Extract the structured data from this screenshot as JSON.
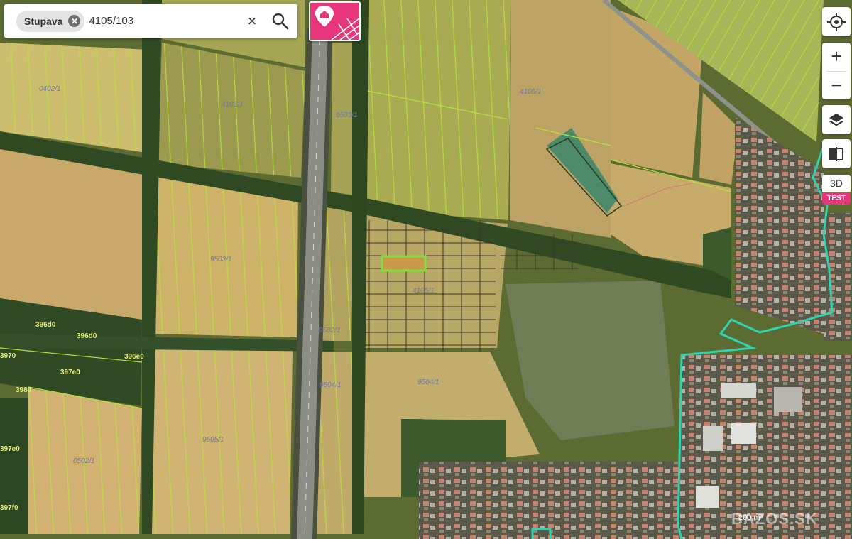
{
  "search": {
    "location_chip": "Stupava",
    "query": "4105/103"
  },
  "controls": {
    "locate_icon": "crosshair-icon",
    "zoom_in": "+",
    "zoom_out": "−",
    "layers_icon": "layers-icon",
    "compare_icon": "compare-icon",
    "view_3d": "3D",
    "test_badge": "TEST"
  },
  "map": {
    "parcel_labels": [
      "0402/1",
      "4103/1",
      "9503/1",
      "4105/1",
      "9504/1",
      "0502/1",
      "9502/1",
      "9504/1",
      "9505/1",
      "4105/1",
      "9503/1"
    ],
    "forest_labels": [
      "396d0",
      "3970",
      "397e0",
      "396d0",
      "397e0",
      "397f0",
      "3980",
      "396e0"
    ],
    "highlight_color": "#7fe03a",
    "boundary_color": "#b8e23a",
    "district_boundary_color": "#2ed3b0"
  },
  "footer": {
    "scale": "200 m",
    "watermark": "BAZOS.SK"
  },
  "colors": {
    "accent": "#e8367a"
  }
}
